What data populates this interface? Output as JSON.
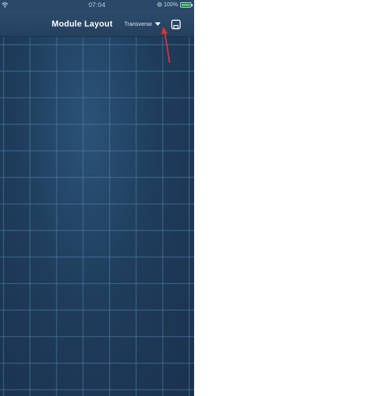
{
  "status_bar": {
    "time": "07:04",
    "battery_text": "100%",
    "wifi_icon": "wifi-icon",
    "location_icon": "location-icon",
    "battery_icon": "battery-icon",
    "battery_level": 1.0,
    "battery_color": "#3ccf4e"
  },
  "navbar": {
    "title": "Module Layout",
    "layout_selector": {
      "selected": "Transverse",
      "icon": "caret-down-icon"
    },
    "save_icon": "save-icon"
  },
  "annotation": {
    "arrow_color": "#e03030"
  },
  "colors": {
    "navbar": "#2a4868",
    "grid_background": "#1f3d5c",
    "grid_lines": "#4f7fa6"
  }
}
